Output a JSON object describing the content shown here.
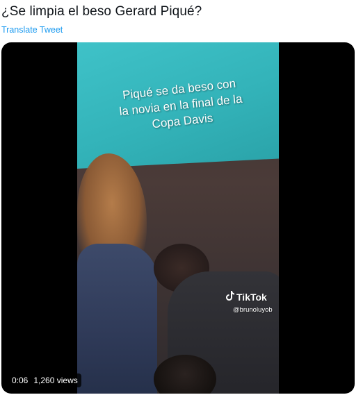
{
  "tweet": {
    "text": "¿Se limpia el beso Gerard Piqué?",
    "translate_label": "Translate Tweet"
  },
  "video": {
    "caption_lines": [
      "Piqué se da beso con",
      "la novia en la final de la",
      "Copa Davis"
    ],
    "watermark_brand": "TikTok",
    "watermark_handle": "@brunoluyob",
    "elapsed_time": "0:06",
    "views": "1,260 views"
  },
  "colors": {
    "link": "#1d9bf0",
    "text": "#0f1419",
    "screen_teal": "#35b6bc"
  },
  "icons": {
    "tiktok": "tiktok-logo-icon"
  }
}
